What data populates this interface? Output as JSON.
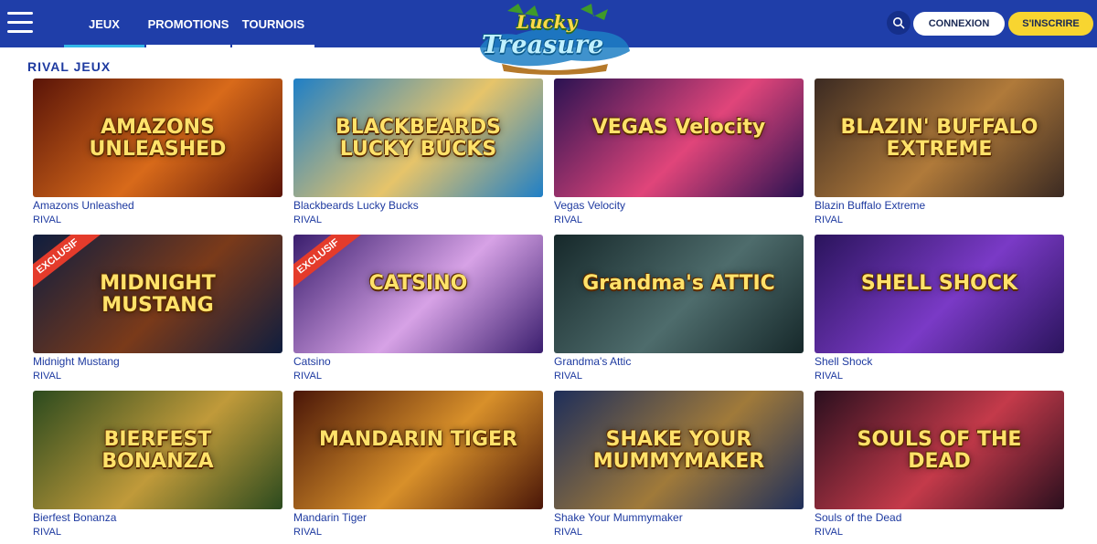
{
  "header": {
    "nav": [
      {
        "label": "JEUX",
        "active": true
      },
      {
        "label": "PROMOTIONS",
        "active": false
      },
      {
        "label": "TOURNOIS",
        "active": false
      }
    ],
    "logo": {
      "line1": "Lucky",
      "line2": "Treasure"
    },
    "login_label": "CONNEXION",
    "signup_label": "S'INSCRIRE",
    "colors": {
      "bar": "#1f3ea9",
      "accent": "#33b7e8",
      "signup": "#f8d530"
    }
  },
  "section": {
    "title": "RIVAL JEUX"
  },
  "games": [
    {
      "name": "Amazons Unleashed",
      "provider": "RIVAL",
      "art": "AMAZONS UNLEASHED",
      "badge": "",
      "c1": "#5a1408",
      "c2": "#d86a1a"
    },
    {
      "name": "Blackbeards Lucky Bucks",
      "provider": "RIVAL",
      "art": "BLACKBEARDS LUCKY BUCKS",
      "badge": "",
      "c1": "#1f7fc6",
      "c2": "#e6c46a"
    },
    {
      "name": "Vegas Velocity",
      "provider": "RIVAL",
      "art": "VEGAS Velocity",
      "badge": "",
      "c1": "#2a1252",
      "c2": "#e0457a"
    },
    {
      "name": "Blazin Buffalo Extreme",
      "provider": "RIVAL",
      "art": "BLAZIN' BUFFALO EXTREME",
      "badge": "",
      "c1": "#3b2a22",
      "c2": "#b07a3a"
    },
    {
      "name": "Midnight Mustang",
      "provider": "RIVAL",
      "art": "MIDNIGHT MUSTANG",
      "badge": "EXCLUSIF",
      "c1": "#0f1d3e",
      "c2": "#7a3a1a"
    },
    {
      "name": "Catsino",
      "provider": "RIVAL",
      "art": "CATSINO",
      "badge": "EXCLUSIF",
      "c1": "#3a1e6e",
      "c2": "#d7a2e6"
    },
    {
      "name": "Grandma's Attic",
      "provider": "RIVAL",
      "art": "Grandma's ATTIC",
      "badge": "",
      "c1": "#16282a",
      "c2": "#4e6c6c"
    },
    {
      "name": "Shell Shock",
      "provider": "RIVAL",
      "art": "SHELL SHOCK",
      "badge": "",
      "c1": "#2a145c",
      "c2": "#7a3ac6"
    },
    {
      "name": "Bierfest Bonanza",
      "provider": "RIVAL",
      "art": "BIERFEST BONANZA",
      "badge": "",
      "c1": "#2b4a1e",
      "c2": "#c09a3a"
    },
    {
      "name": "Mandarin Tiger",
      "provider": "RIVAL",
      "art": "MANDARIN TIGER",
      "badge": "",
      "c1": "#4a1608",
      "c2": "#d8902a"
    },
    {
      "name": "Shake Your Mummymaker",
      "provider": "RIVAL",
      "art": "SHAKE YOUR MUMMYMAKER",
      "badge": "",
      "c1": "#1e2e5a",
      "c2": "#a07a3a"
    },
    {
      "name": "Souls of the Dead",
      "provider": "RIVAL",
      "art": "SOULS OF THE DEAD",
      "badge": "",
      "c1": "#2a0f1e",
      "c2": "#c43a4a"
    }
  ]
}
